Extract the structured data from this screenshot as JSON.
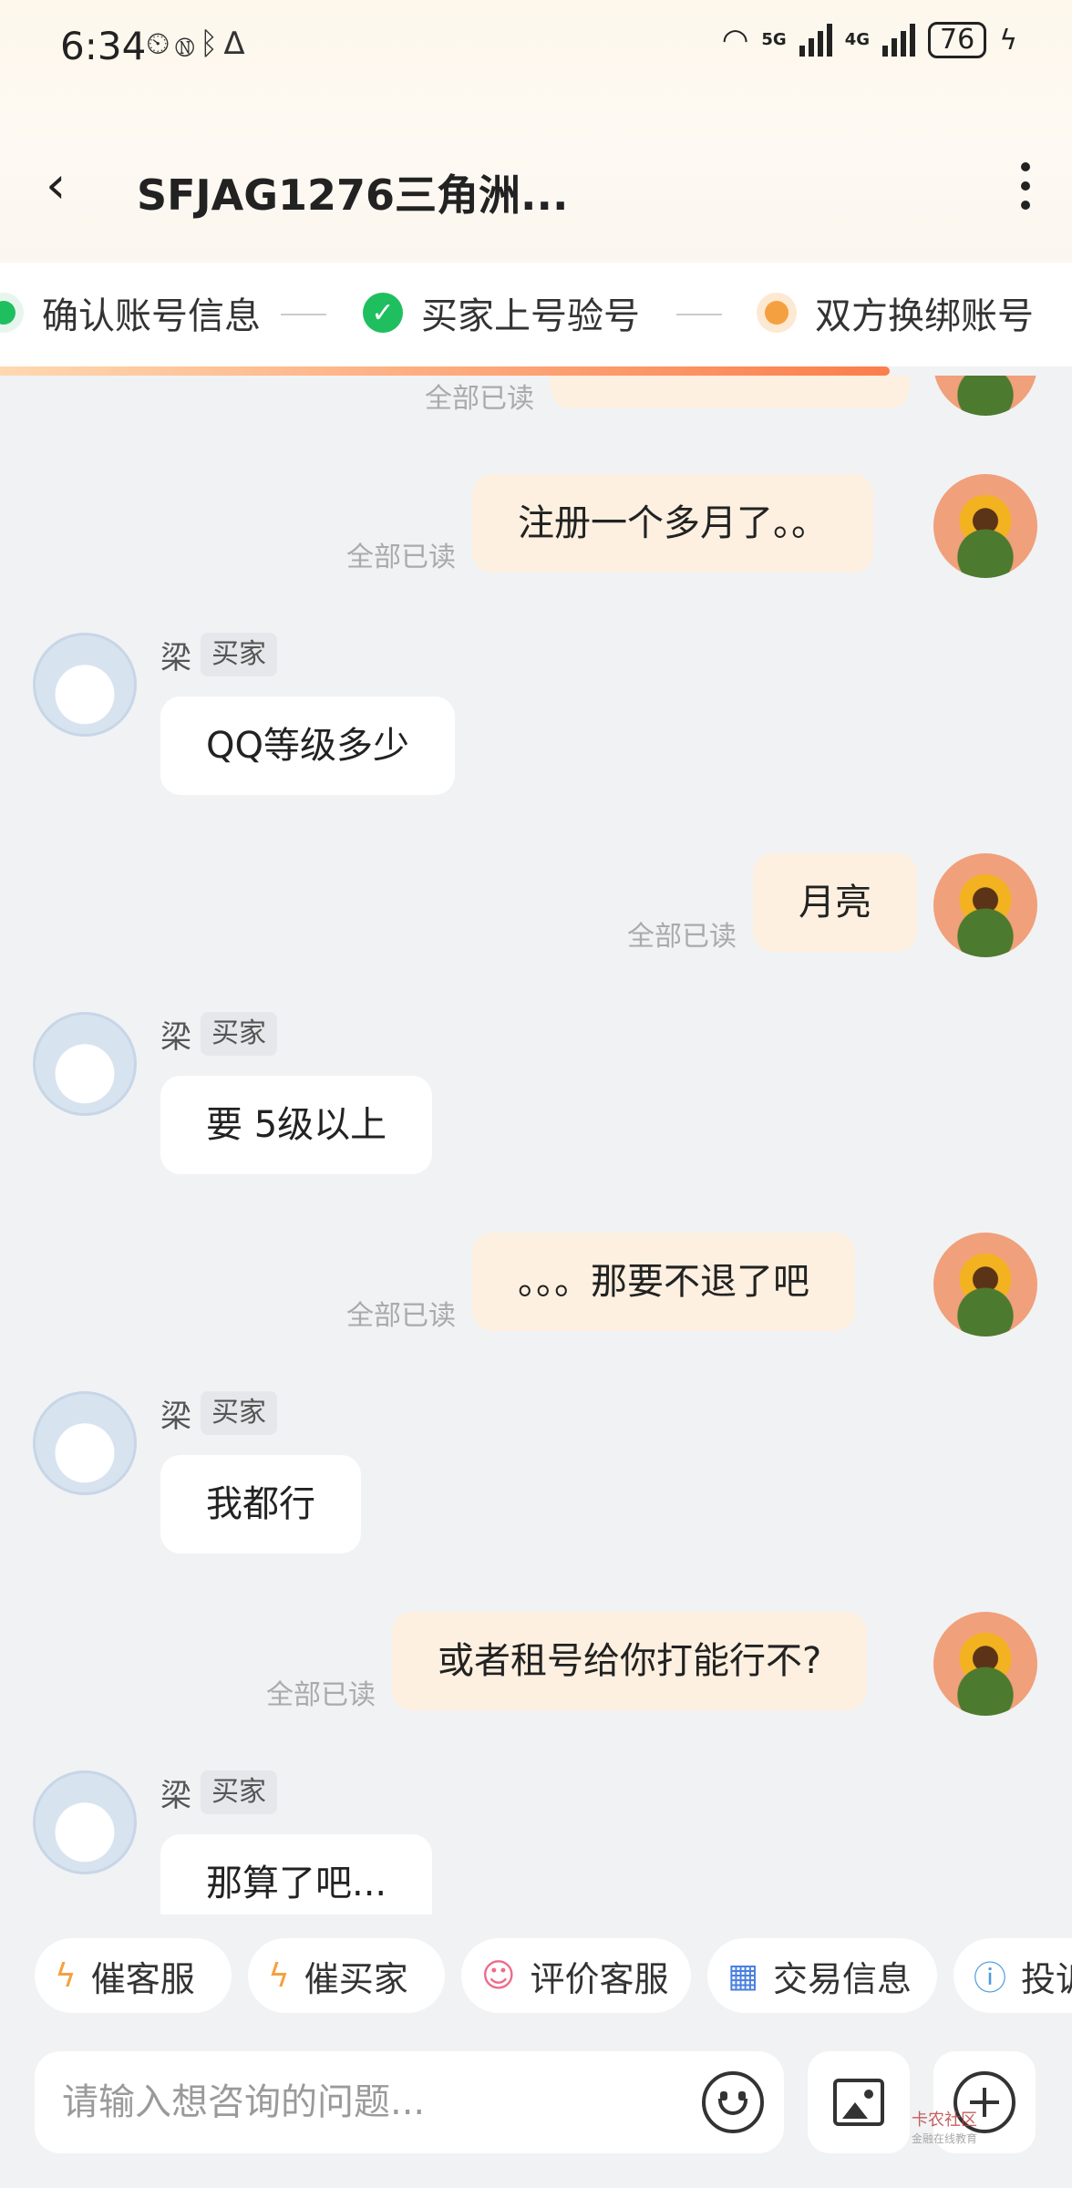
{
  "status_bar": {
    "time": "6:34",
    "battery": "76",
    "net1": "5G",
    "net2": "4G"
  },
  "header": {
    "title": "SFJAG1276三角洲..."
  },
  "steps": [
    {
      "label": "确认账号信息"
    },
    {
      "label": "买家上号验号"
    },
    {
      "label": "双方换绑账号"
    }
  ],
  "progress": 0.83,
  "messages": [
    {
      "from": "me",
      "text": "",
      "status": "全部已读"
    },
    {
      "from": "me",
      "text": "注册一个多月了。。",
      "status": "全部已读"
    },
    {
      "from": "buyer",
      "name": "梁",
      "tag": "买家",
      "text": "QQ等级多少"
    },
    {
      "from": "me",
      "text": "月亮",
      "status": "全部已读"
    },
    {
      "from": "buyer",
      "name": "梁",
      "tag": "买家",
      "text": "要 5级以上"
    },
    {
      "from": "me",
      "text": "。。。那要不退了吧",
      "status": "全部已读"
    },
    {
      "from": "buyer",
      "name": "梁",
      "tag": "买家",
      "text": "我都行"
    },
    {
      "from": "me",
      "text": "或者租号给你打能行不?",
      "status": "全部已读"
    },
    {
      "from": "buyer",
      "name": "梁",
      "tag": "买家",
      "text": "那算了吧..."
    }
  ],
  "quick_actions": [
    {
      "label": "催客服",
      "icon": "lightning-icon"
    },
    {
      "label": "催买家",
      "icon": "lightning-icon"
    },
    {
      "label": "评价客服",
      "icon": "smile-icon"
    },
    {
      "label": "交易信息",
      "icon": "calendar-icon"
    },
    {
      "label": "投诉",
      "icon": "info-icon"
    }
  ],
  "input": {
    "placeholder": "请输入想咨询的问题..."
  },
  "watermark": {
    "line1": "卡农社区",
    "line2": "金融在线教育"
  },
  "colors": {
    "accent": "#fb7e4b",
    "check": "#1fbf5f",
    "pending": "#f5a040",
    "bubble_out": "#fdf0e0"
  }
}
